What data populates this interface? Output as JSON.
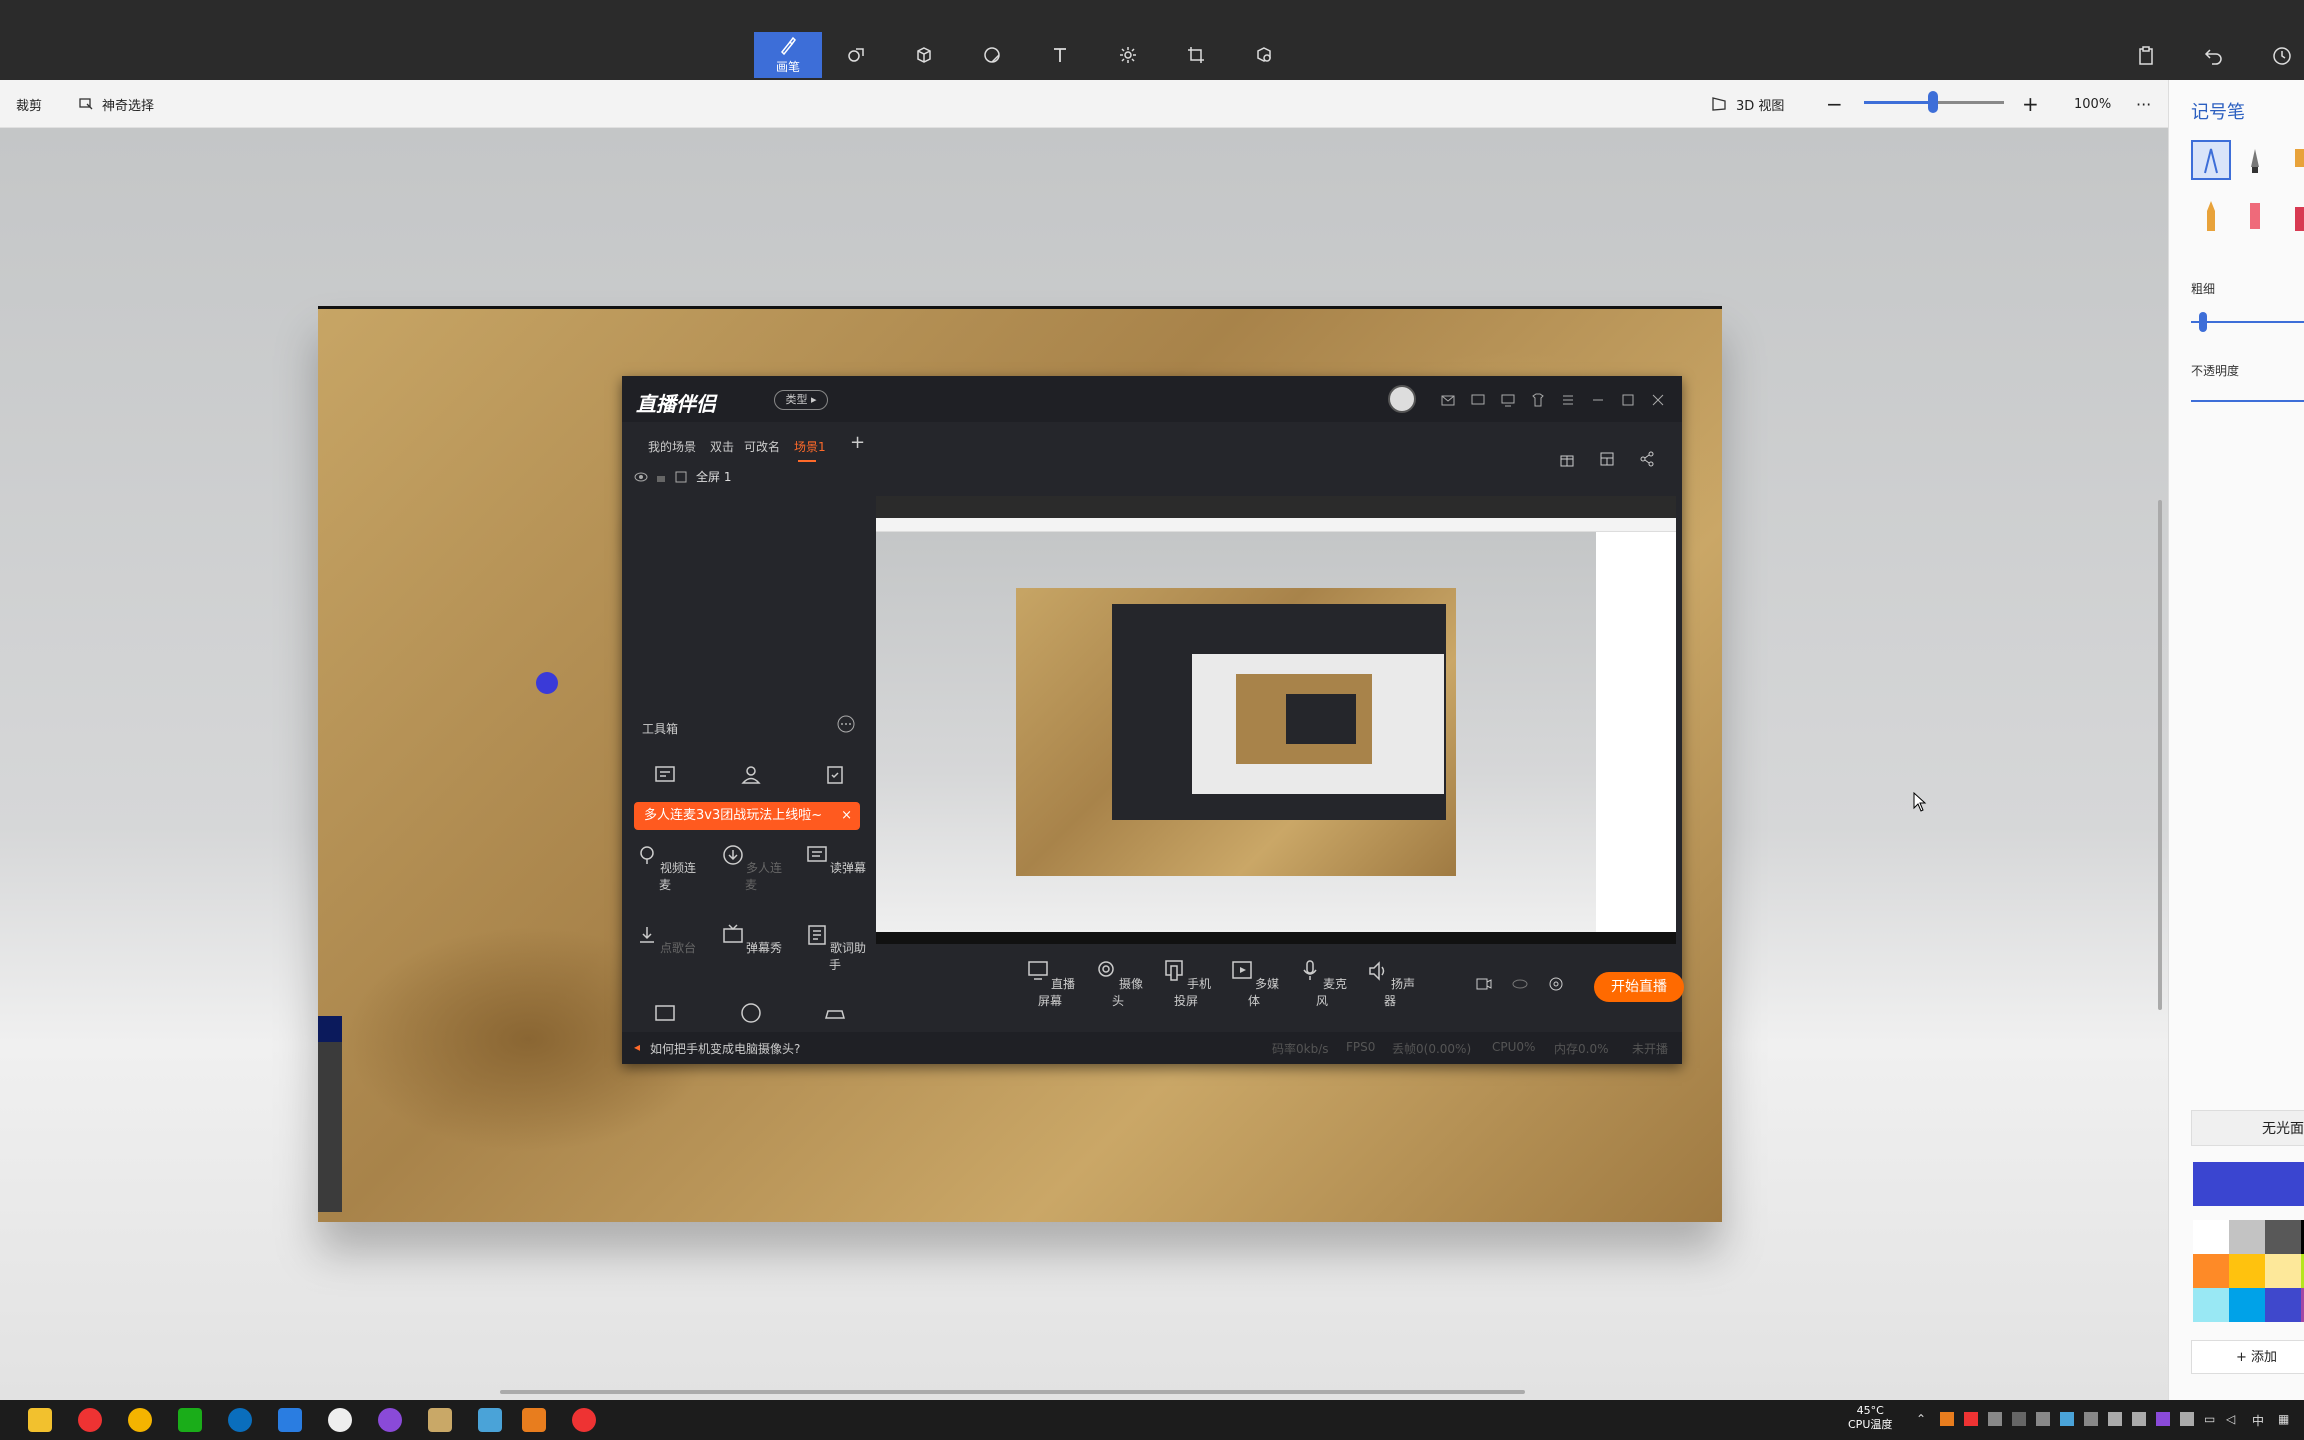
{
  "toolbar": {
    "active_tool_label": "画笔",
    "tools": [
      "brush-icon",
      "shape-2d-icon",
      "shape-3d-icon",
      "sticker-icon",
      "text-icon",
      "effects-icon",
      "canvas-icon",
      "library-icon"
    ]
  },
  "subbar": {
    "crop_label": "裁剪",
    "magic_select_label": "神奇选择",
    "view3d_label": "3D 视图",
    "zoom": "100%"
  },
  "stream_app": {
    "type_button": "类型",
    "scene_tabs": [
      "我的场景",
      "双击",
      "可改名",
      "场景1"
    ],
    "active_tab_index": 3,
    "scene_item": "全屏 1",
    "toolbox_title": "工具箱",
    "promo_text": "多人连麦3v3团战玩法上线啦~",
    "tools_row2": [
      "视频连麦",
      "多人连麦",
      "读弹幕"
    ],
    "tools_row3": [
      "点歌台",
      "弹幕秀",
      "歌词助手"
    ],
    "bottom_buttons": [
      "直播屏幕",
      "摄像头",
      "手机投屏",
      "多媒体",
      "麦克风",
      "扬声器"
    ],
    "start_button": "开始直播",
    "tip_text": "如何把手机变成电脑摄像头?",
    "stats": [
      "码率0kb/s",
      "FPS0",
      "丢帧0(0.00%)",
      "CPU0%",
      "内存0.0%",
      "未开播"
    ]
  },
  "right_panel": {
    "title": "记号笔",
    "thickness_label": "粗细",
    "opacity_label": "不透明度",
    "finish_label": "无光面",
    "add_color_label": "+ 添加",
    "swatches": [
      "#ffffff",
      "#c3c3c3",
      "#585858",
      "#000000",
      "#fe8a27",
      "#ffc20e",
      "#fde89a",
      "#b5e61d",
      "#99e8f4",
      "#00a2e8",
      "#3f48cc",
      "#a349a4"
    ],
    "accent_color": "#3d6ed8",
    "current_color": "#3a45d0"
  },
  "taskbar": {
    "temperature": "45°C",
    "temp_label": "CPU温度",
    "ime": "中"
  }
}
